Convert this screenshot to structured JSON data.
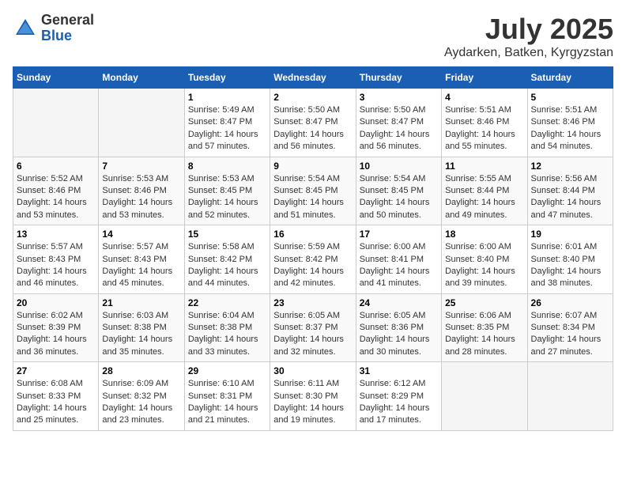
{
  "logo": {
    "general": "General",
    "blue": "Blue"
  },
  "header": {
    "month": "July 2025",
    "location": "Aydarken, Batken, Kyrgyzstan"
  },
  "weekdays": [
    "Sunday",
    "Monday",
    "Tuesday",
    "Wednesday",
    "Thursday",
    "Friday",
    "Saturday"
  ],
  "weeks": [
    [
      {
        "day": "",
        "sunrise": "",
        "sunset": "",
        "daylight": ""
      },
      {
        "day": "",
        "sunrise": "",
        "sunset": "",
        "daylight": ""
      },
      {
        "day": "1",
        "sunrise": "Sunrise: 5:49 AM",
        "sunset": "Sunset: 8:47 PM",
        "daylight": "Daylight: 14 hours and 57 minutes."
      },
      {
        "day": "2",
        "sunrise": "Sunrise: 5:50 AM",
        "sunset": "Sunset: 8:47 PM",
        "daylight": "Daylight: 14 hours and 56 minutes."
      },
      {
        "day": "3",
        "sunrise": "Sunrise: 5:50 AM",
        "sunset": "Sunset: 8:47 PM",
        "daylight": "Daylight: 14 hours and 56 minutes."
      },
      {
        "day": "4",
        "sunrise": "Sunrise: 5:51 AM",
        "sunset": "Sunset: 8:46 PM",
        "daylight": "Daylight: 14 hours and 55 minutes."
      },
      {
        "day": "5",
        "sunrise": "Sunrise: 5:51 AM",
        "sunset": "Sunset: 8:46 PM",
        "daylight": "Daylight: 14 hours and 54 minutes."
      }
    ],
    [
      {
        "day": "6",
        "sunrise": "Sunrise: 5:52 AM",
        "sunset": "Sunset: 8:46 PM",
        "daylight": "Daylight: 14 hours and 53 minutes."
      },
      {
        "day": "7",
        "sunrise": "Sunrise: 5:53 AM",
        "sunset": "Sunset: 8:46 PM",
        "daylight": "Daylight: 14 hours and 53 minutes."
      },
      {
        "day": "8",
        "sunrise": "Sunrise: 5:53 AM",
        "sunset": "Sunset: 8:45 PM",
        "daylight": "Daylight: 14 hours and 52 minutes."
      },
      {
        "day": "9",
        "sunrise": "Sunrise: 5:54 AM",
        "sunset": "Sunset: 8:45 PM",
        "daylight": "Daylight: 14 hours and 51 minutes."
      },
      {
        "day": "10",
        "sunrise": "Sunrise: 5:54 AM",
        "sunset": "Sunset: 8:45 PM",
        "daylight": "Daylight: 14 hours and 50 minutes."
      },
      {
        "day": "11",
        "sunrise": "Sunrise: 5:55 AM",
        "sunset": "Sunset: 8:44 PM",
        "daylight": "Daylight: 14 hours and 49 minutes."
      },
      {
        "day": "12",
        "sunrise": "Sunrise: 5:56 AM",
        "sunset": "Sunset: 8:44 PM",
        "daylight": "Daylight: 14 hours and 47 minutes."
      }
    ],
    [
      {
        "day": "13",
        "sunrise": "Sunrise: 5:57 AM",
        "sunset": "Sunset: 8:43 PM",
        "daylight": "Daylight: 14 hours and 46 minutes."
      },
      {
        "day": "14",
        "sunrise": "Sunrise: 5:57 AM",
        "sunset": "Sunset: 8:43 PM",
        "daylight": "Daylight: 14 hours and 45 minutes."
      },
      {
        "day": "15",
        "sunrise": "Sunrise: 5:58 AM",
        "sunset": "Sunset: 8:42 PM",
        "daylight": "Daylight: 14 hours and 44 minutes."
      },
      {
        "day": "16",
        "sunrise": "Sunrise: 5:59 AM",
        "sunset": "Sunset: 8:42 PM",
        "daylight": "Daylight: 14 hours and 42 minutes."
      },
      {
        "day": "17",
        "sunrise": "Sunrise: 6:00 AM",
        "sunset": "Sunset: 8:41 PM",
        "daylight": "Daylight: 14 hours and 41 minutes."
      },
      {
        "day": "18",
        "sunrise": "Sunrise: 6:00 AM",
        "sunset": "Sunset: 8:40 PM",
        "daylight": "Daylight: 14 hours and 39 minutes."
      },
      {
        "day": "19",
        "sunrise": "Sunrise: 6:01 AM",
        "sunset": "Sunset: 8:40 PM",
        "daylight": "Daylight: 14 hours and 38 minutes."
      }
    ],
    [
      {
        "day": "20",
        "sunrise": "Sunrise: 6:02 AM",
        "sunset": "Sunset: 8:39 PM",
        "daylight": "Daylight: 14 hours and 36 minutes."
      },
      {
        "day": "21",
        "sunrise": "Sunrise: 6:03 AM",
        "sunset": "Sunset: 8:38 PM",
        "daylight": "Daylight: 14 hours and 35 minutes."
      },
      {
        "day": "22",
        "sunrise": "Sunrise: 6:04 AM",
        "sunset": "Sunset: 8:38 PM",
        "daylight": "Daylight: 14 hours and 33 minutes."
      },
      {
        "day": "23",
        "sunrise": "Sunrise: 6:05 AM",
        "sunset": "Sunset: 8:37 PM",
        "daylight": "Daylight: 14 hours and 32 minutes."
      },
      {
        "day": "24",
        "sunrise": "Sunrise: 6:05 AM",
        "sunset": "Sunset: 8:36 PM",
        "daylight": "Daylight: 14 hours and 30 minutes."
      },
      {
        "day": "25",
        "sunrise": "Sunrise: 6:06 AM",
        "sunset": "Sunset: 8:35 PM",
        "daylight": "Daylight: 14 hours and 28 minutes."
      },
      {
        "day": "26",
        "sunrise": "Sunrise: 6:07 AM",
        "sunset": "Sunset: 8:34 PM",
        "daylight": "Daylight: 14 hours and 27 minutes."
      }
    ],
    [
      {
        "day": "27",
        "sunrise": "Sunrise: 6:08 AM",
        "sunset": "Sunset: 8:33 PM",
        "daylight": "Daylight: 14 hours and 25 minutes."
      },
      {
        "day": "28",
        "sunrise": "Sunrise: 6:09 AM",
        "sunset": "Sunset: 8:32 PM",
        "daylight": "Daylight: 14 hours and 23 minutes."
      },
      {
        "day": "29",
        "sunrise": "Sunrise: 6:10 AM",
        "sunset": "Sunset: 8:31 PM",
        "daylight": "Daylight: 14 hours and 21 minutes."
      },
      {
        "day": "30",
        "sunrise": "Sunrise: 6:11 AM",
        "sunset": "Sunset: 8:30 PM",
        "daylight": "Daylight: 14 hours and 19 minutes."
      },
      {
        "day": "31",
        "sunrise": "Sunrise: 6:12 AM",
        "sunset": "Sunset: 8:29 PM",
        "daylight": "Daylight: 14 hours and 17 minutes."
      },
      {
        "day": "",
        "sunrise": "",
        "sunset": "",
        "daylight": ""
      },
      {
        "day": "",
        "sunrise": "",
        "sunset": "",
        "daylight": ""
      }
    ]
  ]
}
